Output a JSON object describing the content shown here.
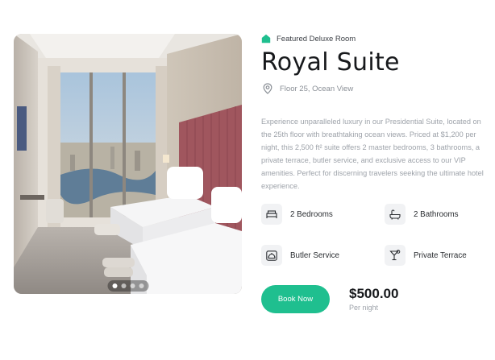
{
  "room": {
    "badge": "Featured Deluxe Room",
    "title": "Royal Suite",
    "location": "Floor 25, Ocean View",
    "description": "Experience unparalleled luxury in our Presidential Suite, located on the 25th floor with breathtaking ocean views. Priced at $1,200 per night, this 2,500 ft² suite offers 2 master bedrooms, 3 bathrooms, a private terrace, butler service, and exclusive access to our VIP amenities. Perfect for discerning travelers seeking the ultimate hotel experience."
  },
  "amenities": [
    {
      "label": "2 Bedrooms",
      "icon": "bed-icon"
    },
    {
      "label": "2 Bathrooms",
      "icon": "bathtub-icon"
    },
    {
      "label": "Butler Service",
      "icon": "butler-bell-icon"
    },
    {
      "label": "Private Terrace",
      "icon": "cocktail-icon"
    }
  ],
  "booking": {
    "button_label": "Book Now",
    "price": "$500.00",
    "price_unit": "Per night"
  },
  "gallery": {
    "slide_count": 4,
    "active_index": 0
  },
  "colors": {
    "accent": "#1fbf8f",
    "headboard": "#a0565e"
  }
}
